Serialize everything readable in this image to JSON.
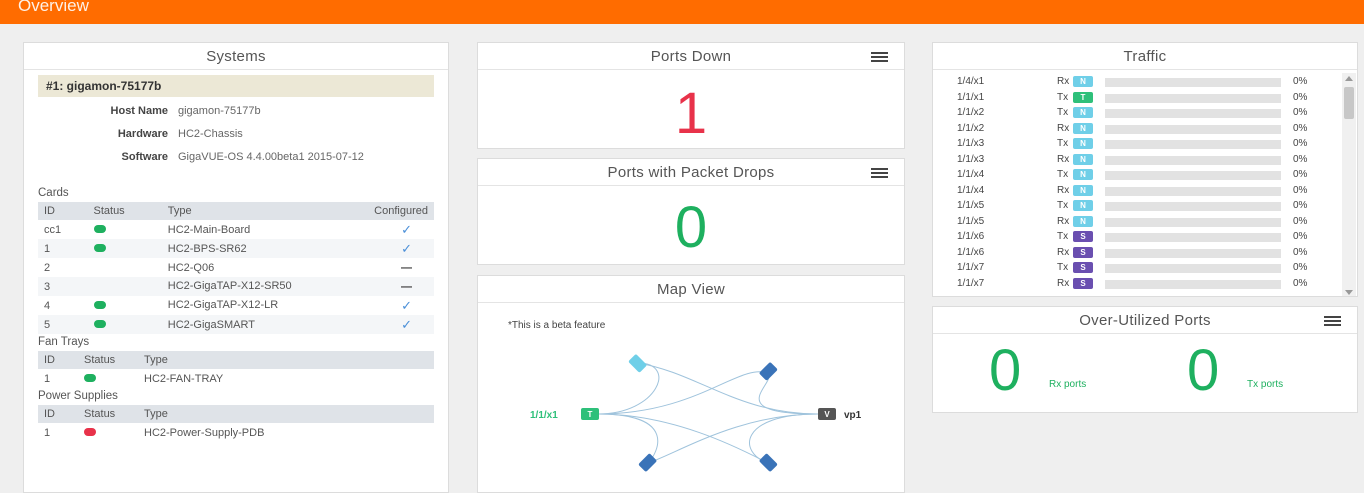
{
  "header": {
    "title": "Overview"
  },
  "systems": {
    "title": "Systems",
    "host_label": "#1: gigamon-75177b",
    "fields": [
      {
        "key": "Host Name",
        "value": "gigamon-75177b"
      },
      {
        "key": "Hardware",
        "value": "HC2-Chassis"
      },
      {
        "key": "Software",
        "value": "GigaVUE-OS 4.4.00beta1 2015-07-12"
      }
    ],
    "cards": {
      "title": "Cards",
      "columns": [
        "ID",
        "Status",
        "Type",
        "Configured"
      ],
      "rows": [
        {
          "id": "cc1",
          "status": "green",
          "type": "HC2-Main-Board",
          "configured": "check"
        },
        {
          "id": "1",
          "status": "green",
          "type": "HC2-BPS-SR62",
          "configured": "check"
        },
        {
          "id": "2",
          "status": "",
          "type": "HC2-Q06",
          "configured": "dash"
        },
        {
          "id": "3",
          "status": "",
          "type": "HC2-GigaTAP-X12-SR50",
          "configured": "dash"
        },
        {
          "id": "4",
          "status": "green",
          "type": "HC2-GigaTAP-X12-LR",
          "configured": "check"
        },
        {
          "id": "5",
          "status": "green",
          "type": "HC2-GigaSMART",
          "configured": "check"
        }
      ]
    },
    "fan_trays": {
      "title": "Fan Trays",
      "columns": [
        "ID",
        "Status",
        "Type"
      ],
      "rows": [
        {
          "id": "1",
          "status": "green",
          "type": "HC2-FAN-TRAY"
        }
      ]
    },
    "power_supplies": {
      "title": "Power Supplies",
      "columns": [
        "ID",
        "Status",
        "Type"
      ],
      "rows": [
        {
          "id": "1",
          "status": "red",
          "type": "HC2-Power-Supply-PDB"
        }
      ]
    }
  },
  "ports_down": {
    "title": "Ports Down",
    "value": "1",
    "color": "#e8324a"
  },
  "packet_drops": {
    "title": "Ports with Packet Drops",
    "value": "0",
    "color": "#1eb05f"
  },
  "map_view": {
    "title": "Map View",
    "note": "*This is a beta feature",
    "nodes": [
      {
        "label": "1/1/x1",
        "badge": "T"
      },
      {
        "label": "vp1",
        "badge": "V"
      }
    ]
  },
  "traffic": {
    "title": "Traffic",
    "rows": [
      {
        "port": "1/4/x1",
        "dir": "Rx",
        "type": "N",
        "pct": "0%"
      },
      {
        "port": "1/1/x1",
        "dir": "Tx",
        "type": "T",
        "pct": "0%"
      },
      {
        "port": "1/1/x2",
        "dir": "Tx",
        "type": "N",
        "pct": "0%"
      },
      {
        "port": "1/1/x2",
        "dir": "Rx",
        "type": "N",
        "pct": "0%"
      },
      {
        "port": "1/1/x3",
        "dir": "Tx",
        "type": "N",
        "pct": "0%"
      },
      {
        "port": "1/1/x3",
        "dir": "Rx",
        "type": "N",
        "pct": "0%"
      },
      {
        "port": "1/1/x4",
        "dir": "Tx",
        "type": "N",
        "pct": "0%"
      },
      {
        "port": "1/1/x4",
        "dir": "Rx",
        "type": "N",
        "pct": "0%"
      },
      {
        "port": "1/1/x5",
        "dir": "Tx",
        "type": "N",
        "pct": "0%"
      },
      {
        "port": "1/1/x5",
        "dir": "Rx",
        "type": "N",
        "pct": "0%"
      },
      {
        "port": "1/1/x6",
        "dir": "Tx",
        "type": "S",
        "pct": "0%"
      },
      {
        "port": "1/1/x6",
        "dir": "Rx",
        "type": "S",
        "pct": "0%"
      },
      {
        "port": "1/1/x7",
        "dir": "Tx",
        "type": "S",
        "pct": "0%"
      },
      {
        "port": "1/1/x7",
        "dir": "Rx",
        "type": "S",
        "pct": "0%"
      }
    ]
  },
  "over_utilized": {
    "title": "Over-Utilized Ports",
    "rx_value": "0",
    "rx_label": "Rx ports",
    "tx_value": "0",
    "tx_label": "Tx ports",
    "color": "#1eb05f"
  },
  "colors": {
    "accent": "#ff6c00",
    "green": "#1eb05f",
    "red": "#e8324a",
    "blue": "#3a73b8"
  }
}
